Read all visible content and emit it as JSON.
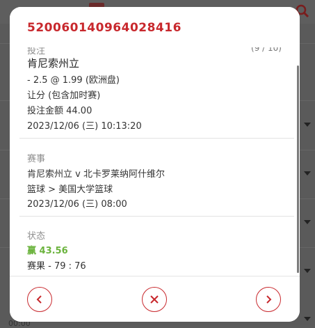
{
  "modal": {
    "ticket_id": "520060140964028416",
    "bet": {
      "label": "投注",
      "odds_count": "(9 / 10)",
      "team": "肯尼索州立",
      "line": "- 2.5 @ 1.99 (欧洲盘)",
      "market": "让分 (包含加时赛)",
      "stake": "投注金额 44.00",
      "placed_time": "2023/12/06 (三) 10:13:20"
    },
    "event": {
      "label": "赛事",
      "match": "肯尼索州立 v 北卡罗莱纳阿什维尔",
      "competition": "篮球 > 美国大学篮球",
      "start_time": "2023/12/06 (三) 08:00"
    },
    "status": {
      "label": "状态",
      "result": "赢 43.56",
      "score": "赛果 - 79 : 76"
    },
    "footer": {
      "prev_icon": "chevron-left-icon",
      "close_icon": "close-icon",
      "next_icon": "chevron-right-icon"
    }
  },
  "colors": {
    "accent": "#c8282d",
    "win": "#6bb33d",
    "overlay": "#5a5a5a"
  },
  "background": {
    "bottom_text": "00:00"
  }
}
